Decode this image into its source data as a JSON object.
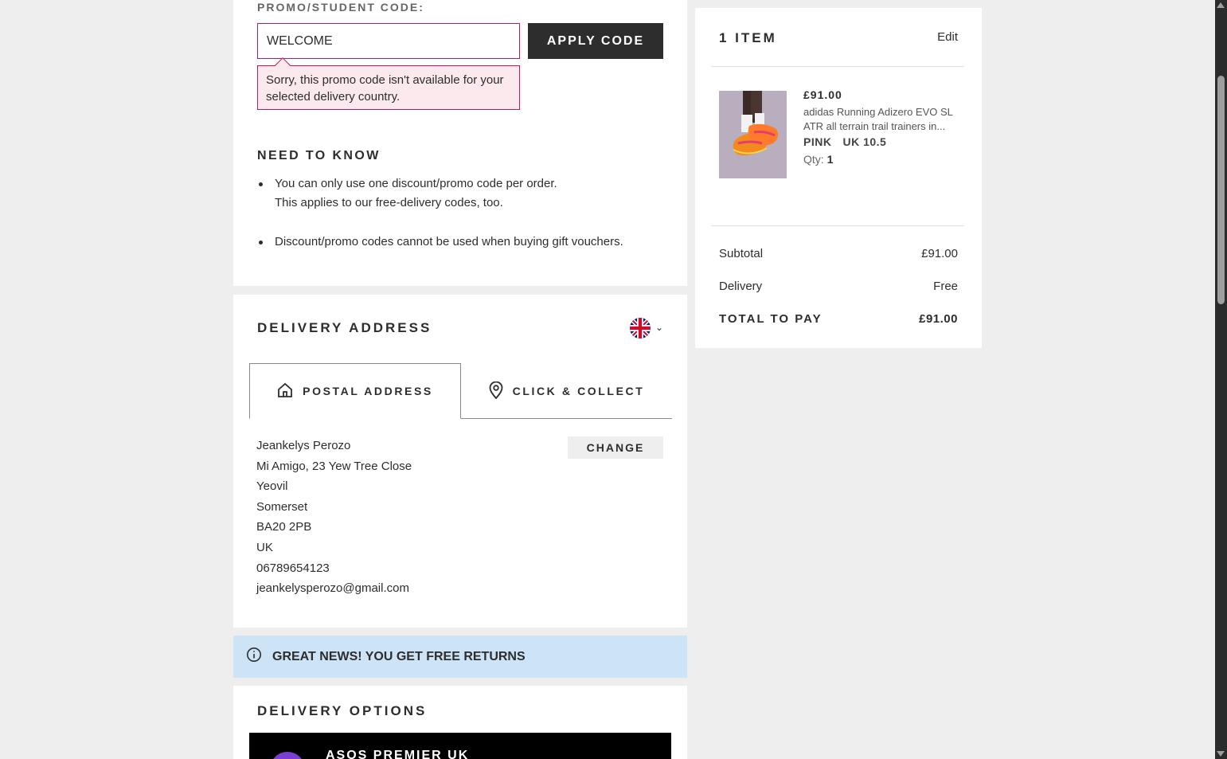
{
  "promo": {
    "label": "PROMO/STUDENT CODE:",
    "input_value": "WELCOME",
    "apply_label": "APPLY CODE",
    "error_message": "Sorry, this promo code isn't available for your selected delivery country."
  },
  "need_to_know": {
    "title": "NEED TO KNOW",
    "items": [
      {
        "line1": "You can only use one discount/promo code per order.",
        "line2": "This applies to our free-delivery codes, too."
      },
      {
        "line1": "Discount/promo codes cannot be used when buying gift vouchers.",
        "line2": ""
      }
    ]
  },
  "delivery_address": {
    "title": "DELIVERY ADDRESS",
    "country_flag_icon": "uk-flag-icon",
    "tabs": [
      {
        "label": "POSTAL ADDRESS",
        "icon": "house-icon",
        "active": true
      },
      {
        "label": "CLICK & COLLECT",
        "icon": "location-pin-icon",
        "active": false
      }
    ],
    "address_lines": [
      "Jeankelys Perozo",
      "Mi Amigo, 23 Yew Tree Close",
      "Yeovil",
      "Somerset",
      "BA20 2PB",
      "UK",
      "06789654123",
      "jeankelysperozo@gmail.com"
    ],
    "change_label": "CHANGE"
  },
  "returns_banner": {
    "icon": "info-icon",
    "text": "GREAT NEWS! YOU GET FREE RETURNS"
  },
  "delivery_options": {
    "title": "DELIVERY OPTIONS",
    "premier_label": "ASOS PREMIER UK"
  },
  "summary": {
    "item_count": "1 ITEM",
    "edit_label": "Edit",
    "product": {
      "price": "£91.00",
      "name": "adidas Running Adizero EVO SL ATR all terrain trail trainers in...",
      "colour": "PINK",
      "size": "UK 10.5",
      "qty_label": "Qty:",
      "qty": "1"
    },
    "subtotal_label": "Subtotal",
    "subtotal_value": "£91.00",
    "delivery_label": "Delivery",
    "delivery_value": "Free",
    "total_label": "TOTAL TO PAY",
    "total_value": "£91.00"
  },
  "colors": {
    "background": "#eeeeee",
    "error_border": "#c2185b",
    "error_bg": "#fbe9ee",
    "banner_bg": "#cde3f6",
    "dark": "#2d2d2d"
  }
}
